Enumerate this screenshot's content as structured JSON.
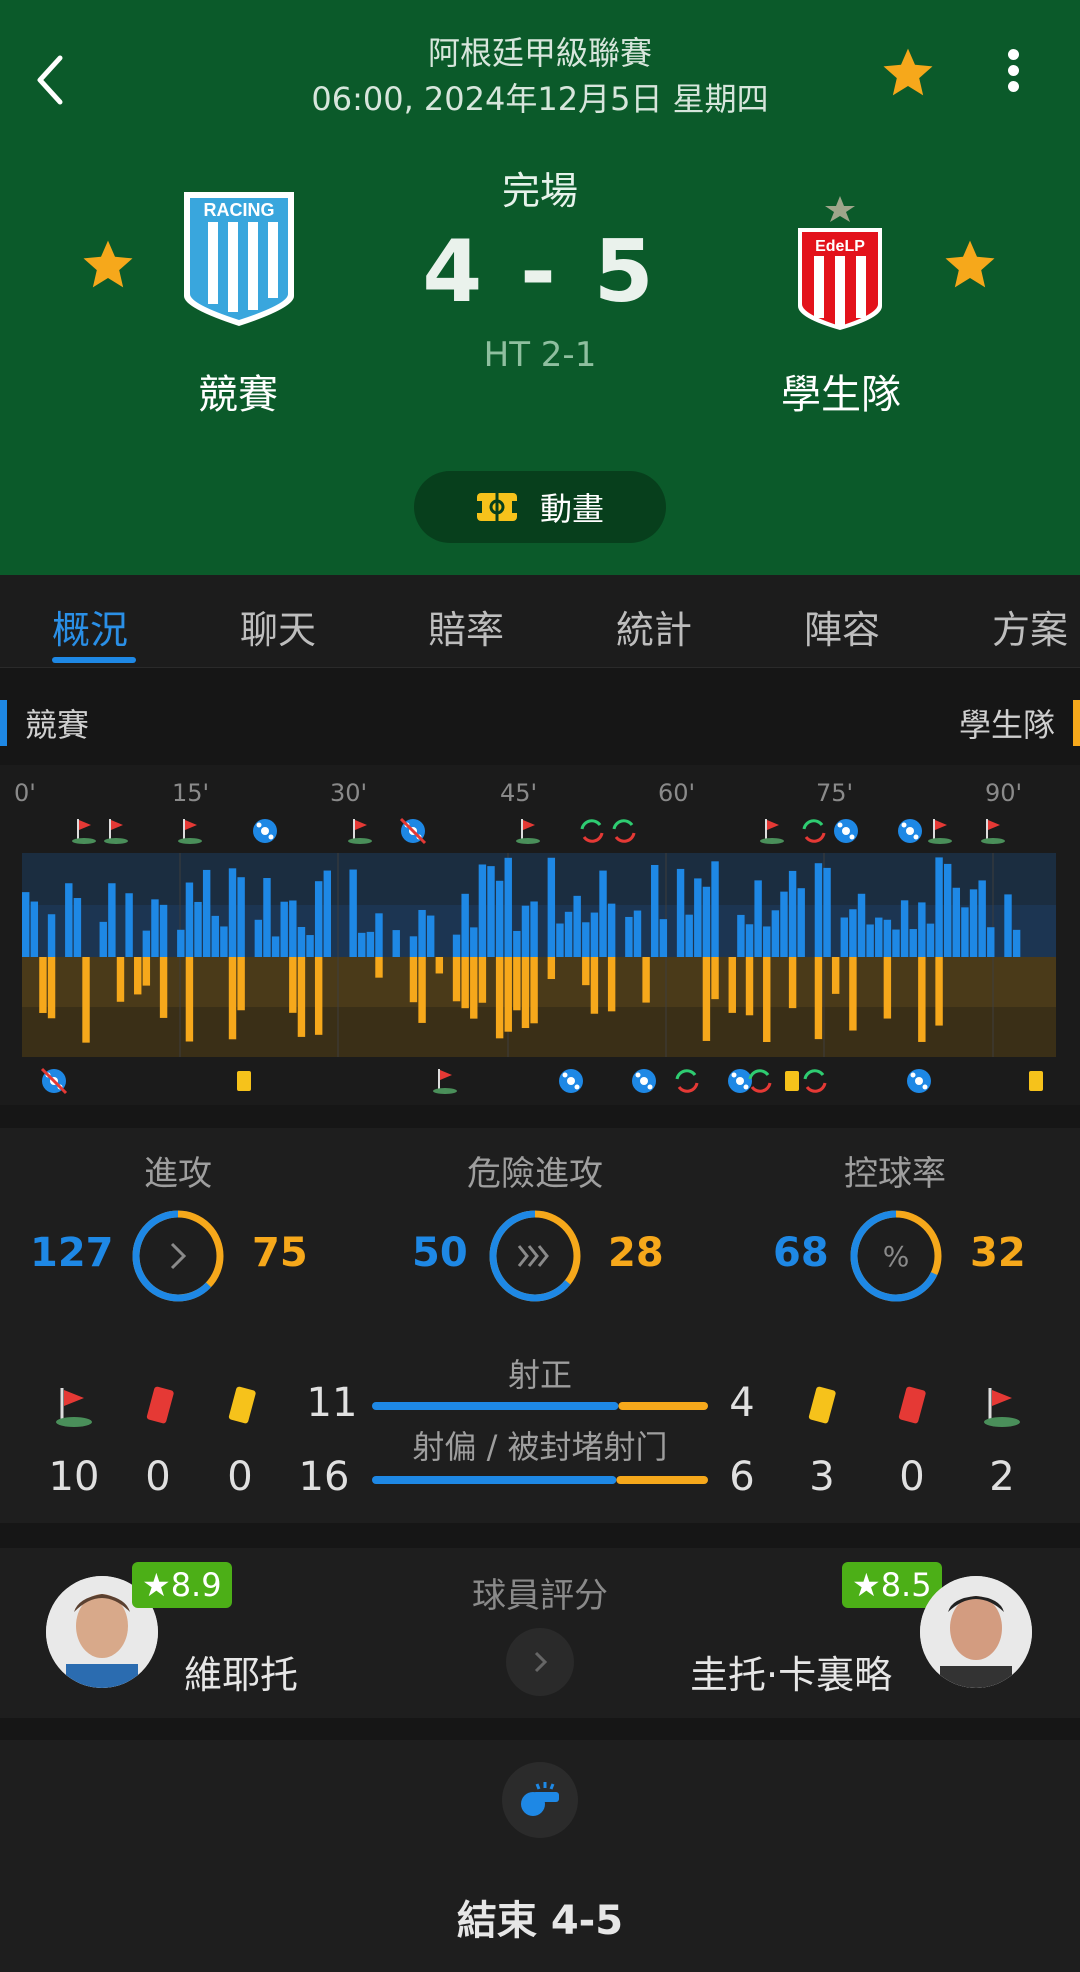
{
  "header": {
    "league": "阿根廷甲級聯賽",
    "datetime": "06:00, 2024年12月5日 星期四",
    "status": "完場",
    "score": "4 - 5",
    "halftime": "HT 2-1",
    "home_team": "競賽",
    "away_team": "學生隊",
    "home_logo_text": "RACING",
    "away_logo_text": "EdeLP",
    "animation_label": "動畫",
    "colors": {
      "header_bg": "#0b5a2a",
      "star": "#f6a81b"
    }
  },
  "tabs": [
    {
      "label": "概況",
      "active": true
    },
    {
      "label": "聊天"
    },
    {
      "label": "賠率"
    },
    {
      "label": "統計"
    },
    {
      "label": "陣容"
    },
    {
      "label": "方案"
    }
  ],
  "momentum": {
    "home_label": "競賽",
    "away_label": "學生隊",
    "minute_labels": [
      "0'",
      "15'",
      "30'",
      "45'",
      "60'",
      "75'",
      "90'"
    ],
    "home_events": [
      "corner",
      "corner",
      "corner",
      "goal",
      "corner",
      "goal-disallowed",
      "corner",
      "substitution",
      "substitution",
      "corner",
      "substitution",
      "goal",
      "goal",
      "corner",
      "corner"
    ],
    "away_events": [
      "goal-disallowed",
      "yellow-card",
      "corner",
      "goal",
      "goal",
      "substitution",
      "goal",
      "substitution",
      "yellow-card",
      "substitution",
      "goal",
      "yellow-card"
    ],
    "colors": {
      "home": "#1e88e5",
      "away": "#f6a81b"
    }
  },
  "stats": {
    "attacks": {
      "label": "進攻",
      "home": "127",
      "away": "75",
      "icon": "chevron-right-icon"
    },
    "dangerous_attacks": {
      "label": "危險進攻",
      "home": "50",
      "away": "28",
      "icon": "triple-chevron-icon"
    },
    "possession": {
      "label": "控球率",
      "home": "68",
      "away": "32",
      "icon": "percent-icon"
    },
    "shots_on_target_label": "射正",
    "shots_off_label": "射偏 / 被封堵射门",
    "home": {
      "corners": "10",
      "red": "0",
      "yellow": "0",
      "on_target": "11",
      "off_target": "16"
    },
    "away": {
      "corners": "2",
      "red": "0",
      "yellow": "3",
      "on_target": "4",
      "off_target": "6"
    }
  },
  "players": {
    "title": "球員評分",
    "home": {
      "name": "維耶托",
      "rating": "★8.9"
    },
    "away": {
      "name": "圭托·卡裏略",
      "rating": "★8.5"
    }
  },
  "timeline": {
    "end_text": "結束 4-5"
  }
}
